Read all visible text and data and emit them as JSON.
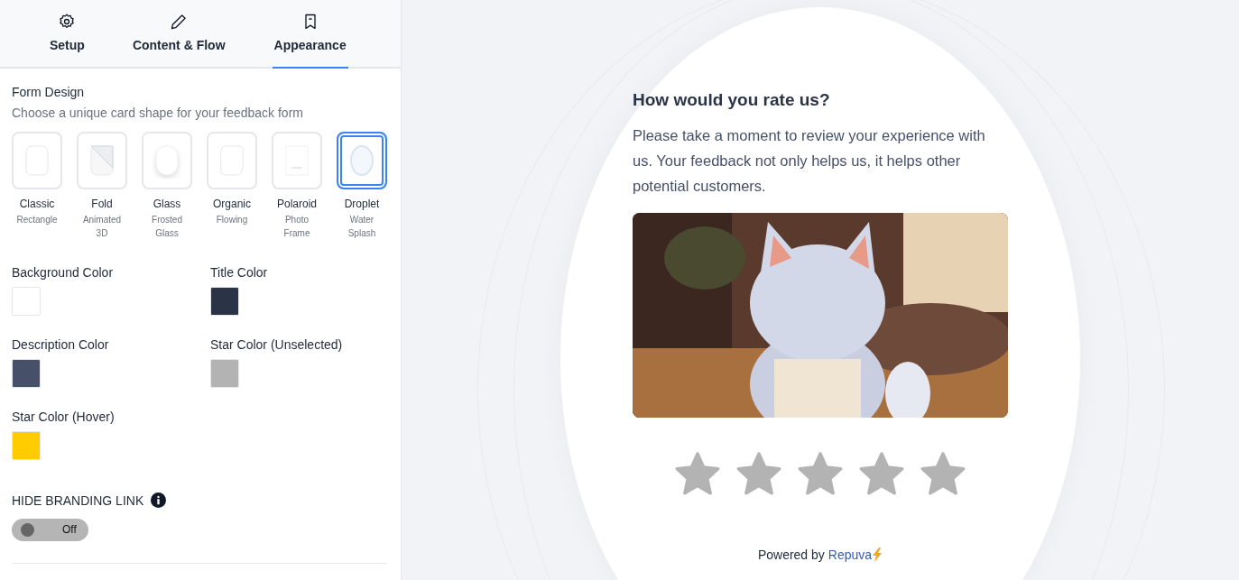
{
  "tabs": [
    {
      "label": "Setup",
      "selected": false
    },
    {
      "label": "Content & Flow",
      "selected": false
    },
    {
      "label": "Appearance",
      "selected": true
    }
  ],
  "form_design": {
    "title": "Form Design",
    "subtitle": "Choose a unique card shape for your feedback form",
    "options": [
      {
        "name": "Classic",
        "description": "Rectangle",
        "selected": false
      },
      {
        "name": "Fold",
        "description": "Animated 3D",
        "selected": false
      },
      {
        "name": "Glass",
        "description": "Frosted Glass",
        "selected": false
      },
      {
        "name": "Organic",
        "description": "Flowing",
        "selected": false
      },
      {
        "name": "Polaroid",
        "description": "Photo Frame",
        "selected": false
      },
      {
        "name": "Droplet",
        "description": "Water Splash",
        "selected": true
      }
    ]
  },
  "colors": [
    {
      "label": "Background Color",
      "color": "#ffffff"
    },
    {
      "label": "Title Color",
      "color": "#2b3447"
    },
    {
      "label": "Description Color",
      "color": "#475069"
    },
    {
      "label": "Star Color (Unselected)",
      "color": "#b3b3b3"
    },
    {
      "label": "Star Color (Hover)",
      "color": "#ffcc00"
    }
  ],
  "branding": {
    "label": "HIDE BRANDING LINK",
    "on": false,
    "state": "Off"
  },
  "preview": {
    "title": "How would you rate us?",
    "description": "Please take a moment to review your experience with us. Your feedback not only helps us, it helps other potential customers.",
    "rating": {
      "stars": 0
    },
    "powered_by": "Powered by",
    "brand": "Repuva"
  }
}
